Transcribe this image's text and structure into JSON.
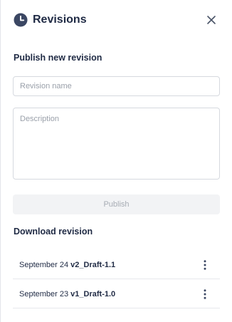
{
  "panel": {
    "title": "Revisions",
    "icons": {
      "header": "clock-icon",
      "close": "close-icon",
      "row_menu": "more-vertical-icon"
    },
    "colors": {
      "text": "#1f2a44",
      "muted": "#9aa0aa",
      "border": "#d6d9df",
      "disabled_bg": "#f2f3f5"
    }
  },
  "publish": {
    "heading": "Publish new revision",
    "name_value": "",
    "name_placeholder": "Revision name",
    "description_value": "",
    "description_placeholder": "Description",
    "button_label": "Publish"
  },
  "download": {
    "heading": "Download revision",
    "revisions": [
      {
        "date": "September 24",
        "name": "v2_Draft-1.1"
      },
      {
        "date": "September 23",
        "name": "v1_Draft-1.0"
      }
    ]
  }
}
